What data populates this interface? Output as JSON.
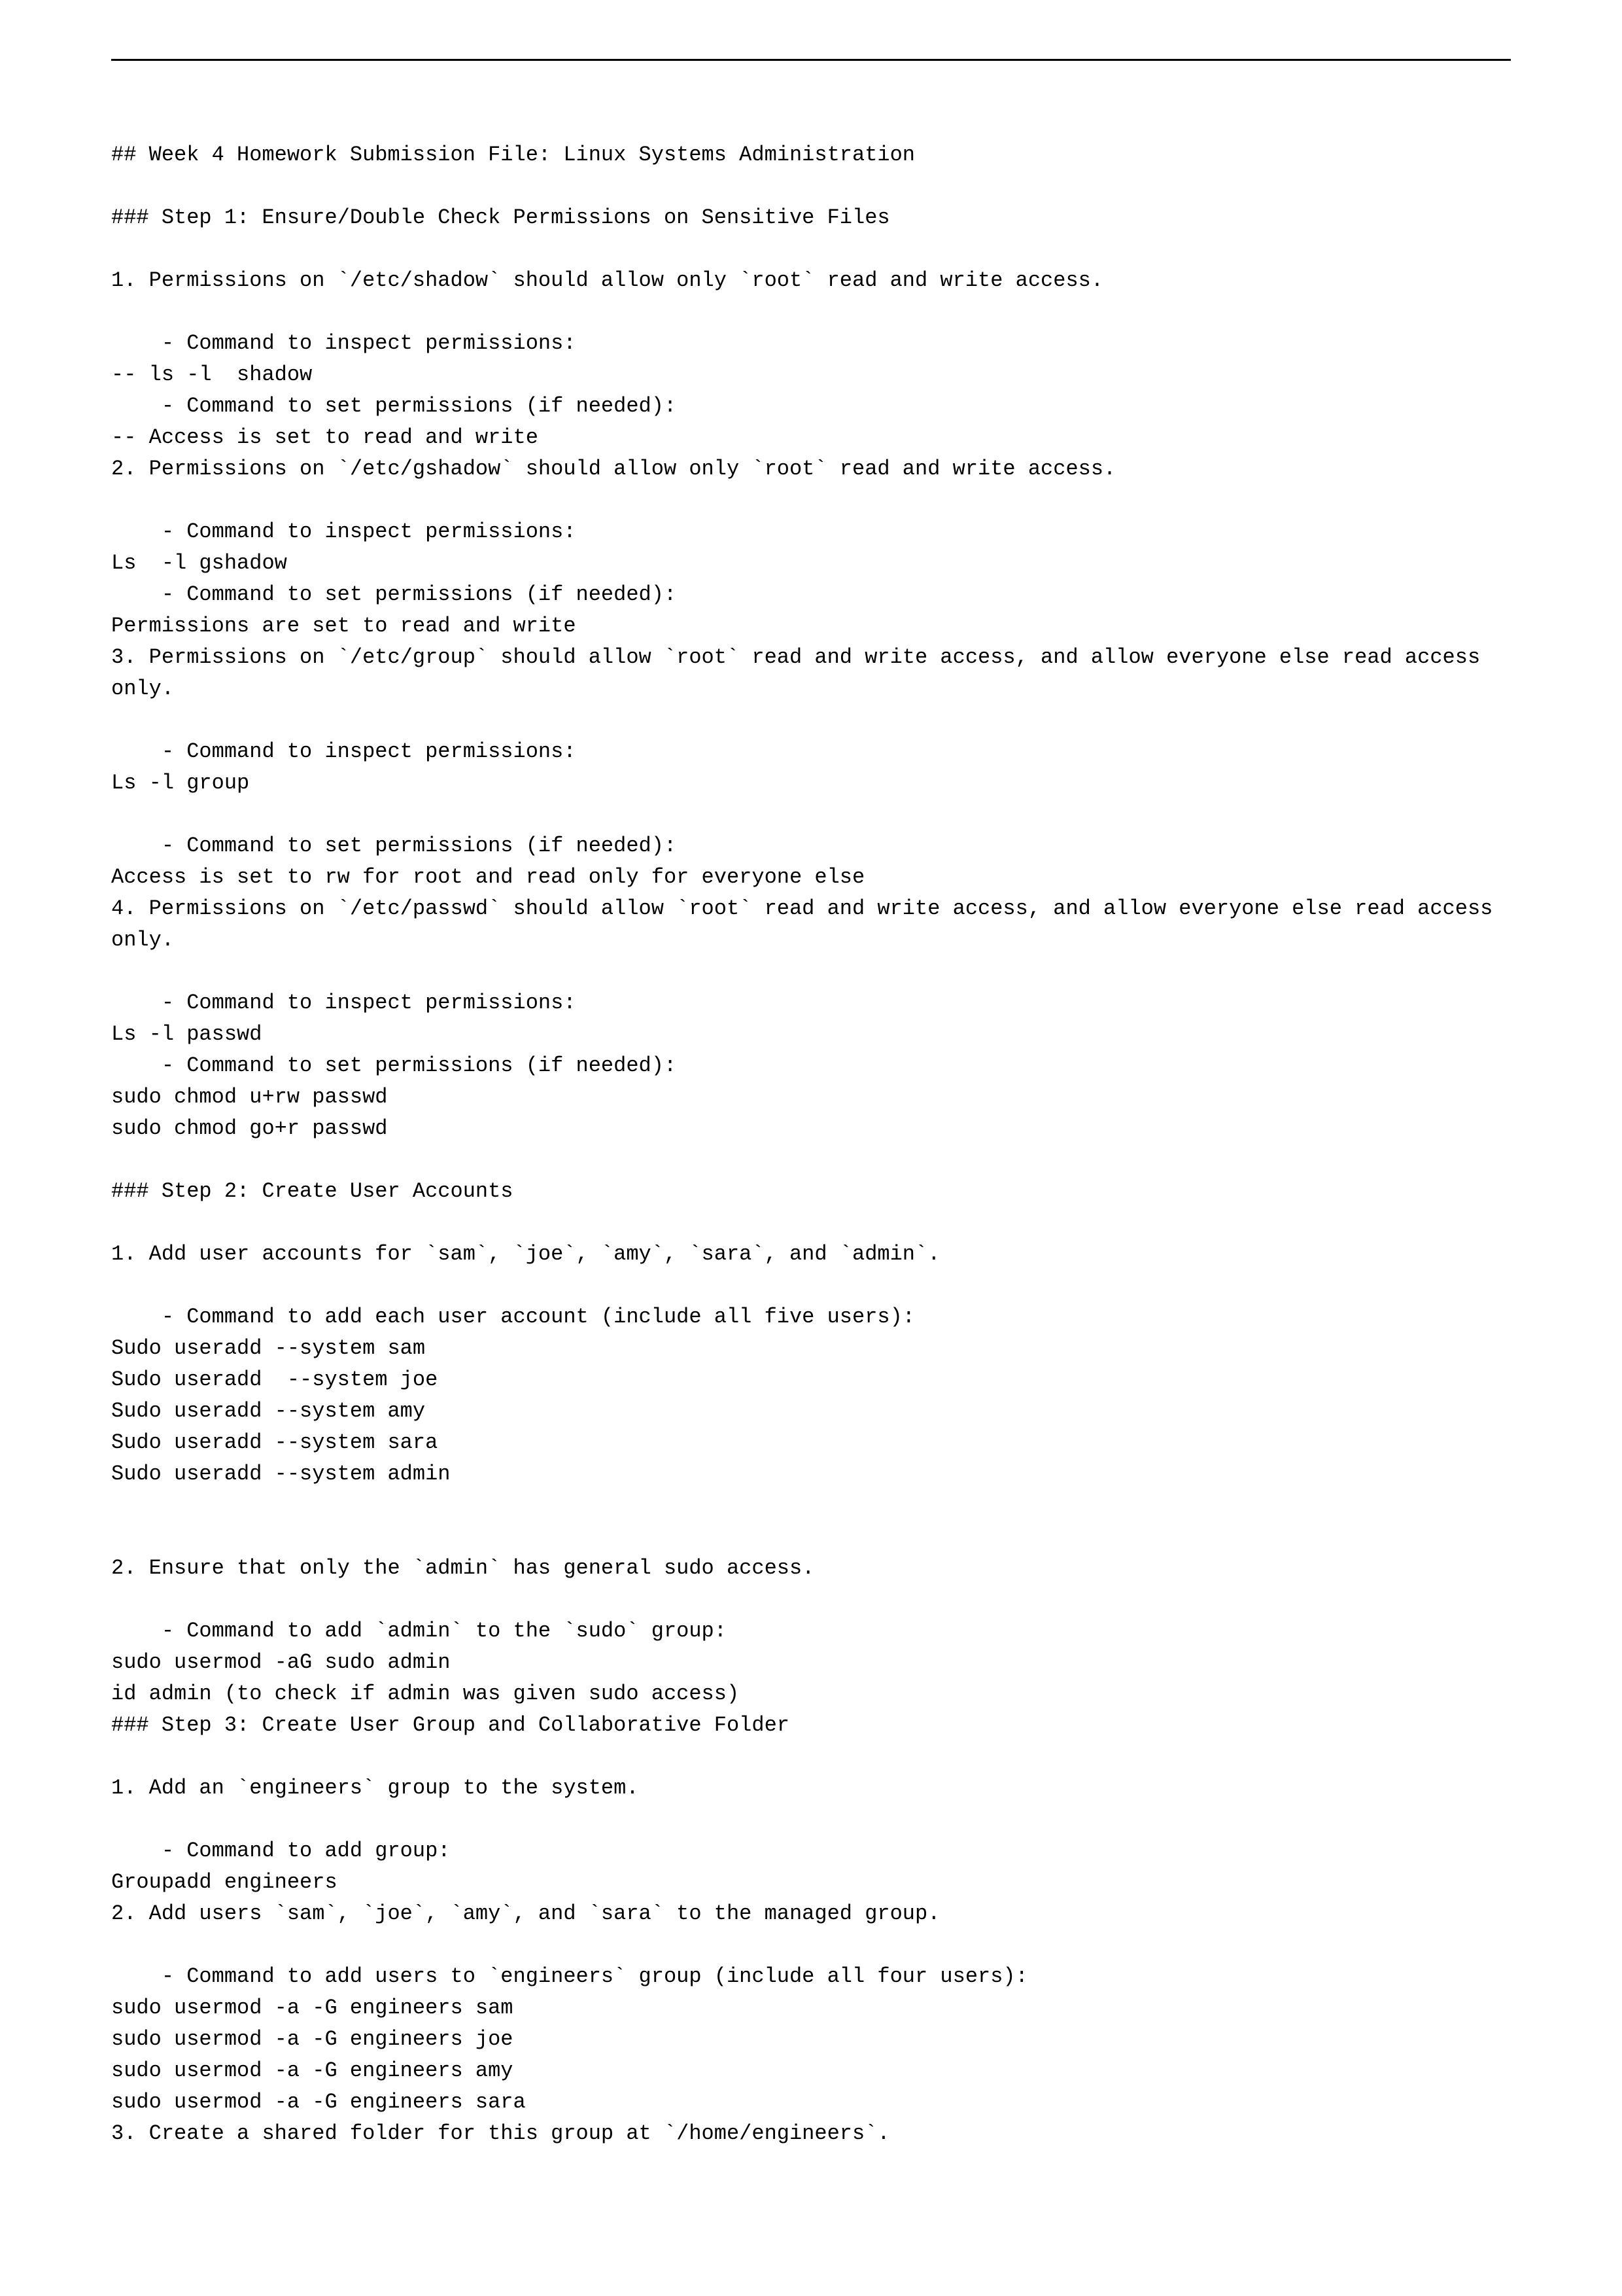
{
  "lines": [
    "## Week 4 Homework Submission File: Linux Systems Administration",
    "",
    "### Step 1: Ensure/Double Check Permissions on Sensitive Files",
    "",
    "1. Permissions on `/etc/shadow` should allow only `root` read and write access.",
    "",
    "    - Command to inspect permissions:",
    "-- ls -l  shadow",
    "    - Command to set permissions (if needed):",
    "-- Access is set to read and write",
    "2. Permissions on `/etc/gshadow` should allow only `root` read and write access.",
    "",
    "    - Command to inspect permissions:",
    "Ls  -l gshadow",
    "    - Command to set permissions (if needed):",
    "Permissions are set to read and write",
    "3. Permissions on `/etc/group` should allow `root` read and write access, and allow everyone else read access only.",
    "",
    "    - Command to inspect permissions:",
    "Ls -l group",
    "",
    "    - Command to set permissions (if needed):",
    "Access is set to rw for root and read only for everyone else",
    "4. Permissions on `/etc/passwd` should allow `root` read and write access, and allow everyone else read access only.",
    "",
    "    - Command to inspect permissions:",
    "Ls -l passwd",
    "    - Command to set permissions (if needed):",
    "sudo chmod u+rw passwd",
    "sudo chmod go+r passwd",
    "",
    "### Step 2: Create User Accounts",
    "",
    "1. Add user accounts for `sam`, `joe`, `amy`, `sara`, and `admin`.",
    "",
    "    - Command to add each user account (include all five users):",
    "Sudo useradd --system sam",
    "Sudo useradd  --system joe",
    "Sudo useradd --system amy",
    "Sudo useradd --system sara",
    "Sudo useradd --system admin",
    "",
    "",
    "2. Ensure that only the `admin` has general sudo access.",
    "",
    "    - Command to add `admin` to the `sudo` group:",
    "sudo usermod -aG sudo admin",
    "id admin (to check if admin was given sudo access)",
    "### Step 3: Create User Group and Collaborative Folder",
    "",
    "1. Add an `engineers` group to the system.",
    "",
    "    - Command to add group:",
    "Groupadd engineers",
    "2. Add users `sam`, `joe`, `amy`, and `sara` to the managed group.",
    "",
    "    - Command to add users to `engineers` group (include all four users):",
    "sudo usermod -a -G engineers sam",
    "sudo usermod -a -G engineers joe",
    "sudo usermod -a -G engineers amy",
    "sudo usermod -a -G engineers sara",
    "3. Create a shared folder for this group at `/home/engineers`."
  ]
}
